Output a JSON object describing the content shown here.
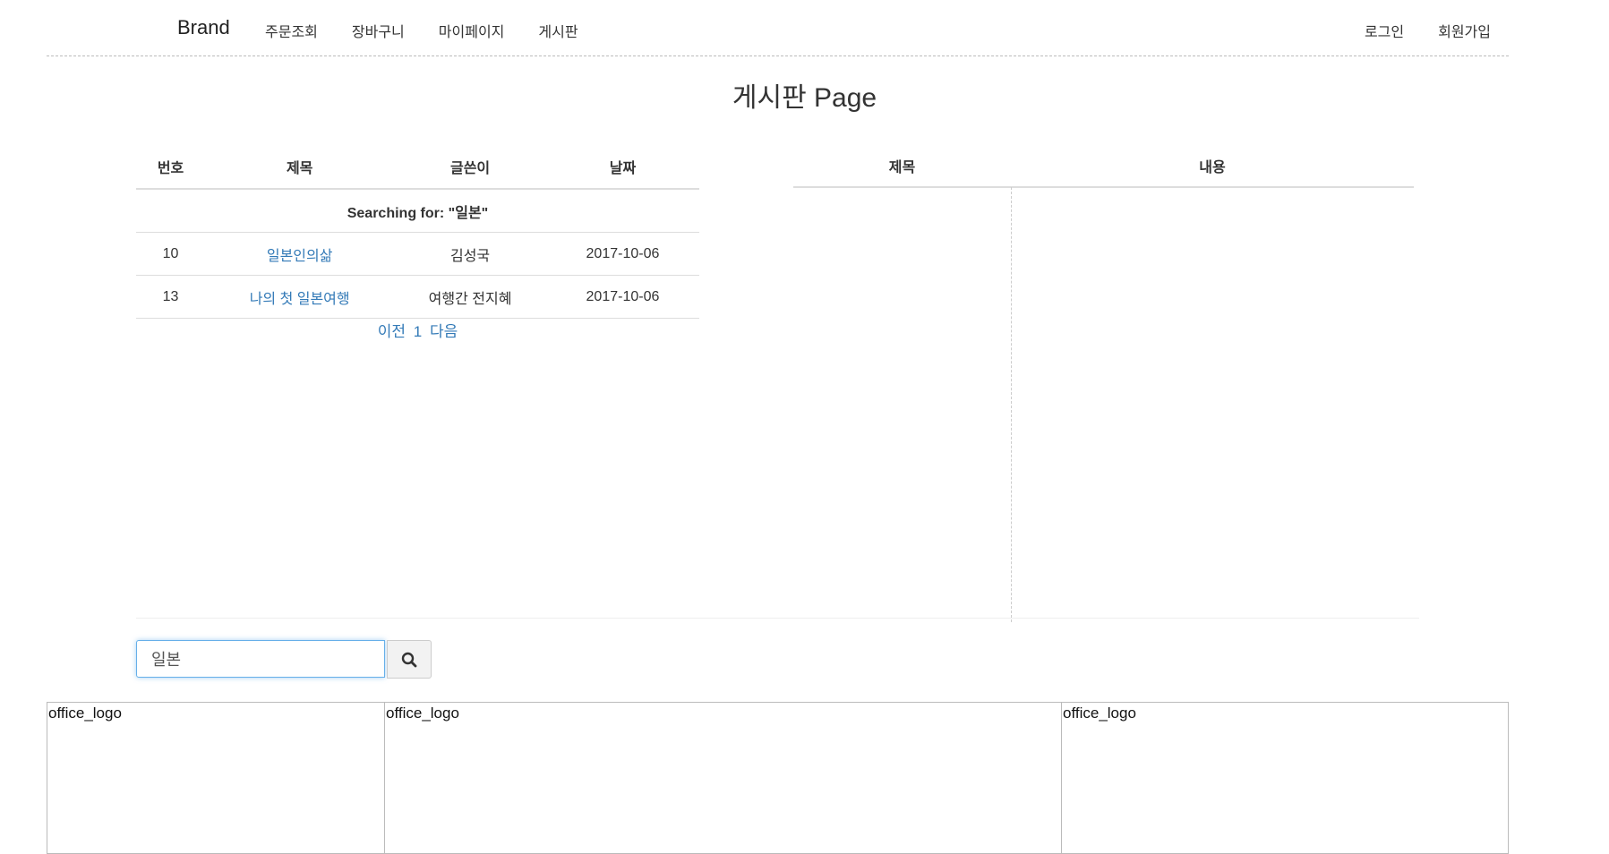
{
  "navbar": {
    "brand": "Brand",
    "left_items": [
      "주문조회",
      "장바구니",
      "마이페이지",
      "게시판"
    ],
    "right_items": [
      "로그인",
      "회원가입"
    ]
  },
  "page_title": "게시판 Page",
  "board": {
    "headers": [
      "번호",
      "제목",
      "글쓴이",
      "날짜"
    ],
    "searching_text": "Searching for: \"일본\"",
    "rows": [
      {
        "no": "10",
        "title": "일본인의삶",
        "author": "김성국",
        "date": "2017-10-06"
      },
      {
        "no": "13",
        "title": "나의 첫 일본여행",
        "author": "여행간 전지혜",
        "date": "2017-10-06"
      }
    ],
    "pager": {
      "prev": "이전",
      "page": "1",
      "next": "다음"
    }
  },
  "preview": {
    "headers": [
      "제목",
      "내용"
    ]
  },
  "search": {
    "value": "일본",
    "button_icon": "search-icon"
  },
  "footer": {
    "boxes": [
      "office_logo",
      "office_logo",
      "office_logo"
    ]
  },
  "colors": {
    "link": "#337ab7",
    "focus_border": "#66afe9"
  }
}
